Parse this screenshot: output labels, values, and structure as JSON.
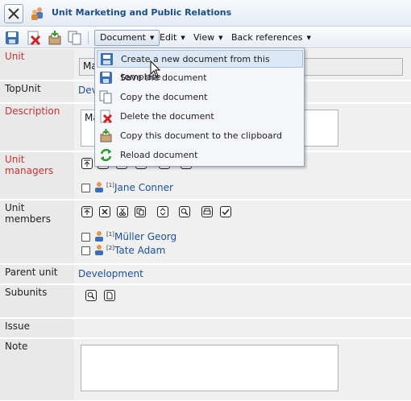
{
  "window": {
    "title": "Unit Marketing and Public Relations"
  },
  "toolbar": {
    "menus": [
      {
        "label": "Document"
      },
      {
        "label": "Edit"
      },
      {
        "label": "View"
      },
      {
        "label": "Back references"
      }
    ]
  },
  "document_menu": {
    "items": [
      {
        "label": "Create a new document from this template",
        "icon": "template-icon"
      },
      {
        "label": "Save the document",
        "icon": "save-icon"
      },
      {
        "label": "Copy the document",
        "icon": "copy-icon"
      },
      {
        "label": "Delete the document",
        "icon": "delete-icon"
      },
      {
        "label": "Copy this document to the clipboard",
        "icon": "clipboard-icon"
      },
      {
        "label": "Reload document",
        "icon": "reload-icon"
      }
    ]
  },
  "form": {
    "unit": {
      "label": "Unit",
      "value": "Ma"
    },
    "topunit": {
      "label": "TopUnit",
      "value": "Dev"
    },
    "description": {
      "label": "Description",
      "value": "Ma"
    },
    "unit_managers": {
      "label": "Unit managers",
      "people": [
        {
          "index": "[1]",
          "name": "Jane Conner"
        }
      ]
    },
    "unit_members": {
      "label": "Unit members",
      "people": [
        {
          "index": "[1]",
          "name": "Müller Georg"
        },
        {
          "index": "[2]",
          "name": "Tate Adam"
        }
      ]
    },
    "parent_unit": {
      "label": "Parent unit",
      "value": "Development"
    },
    "subunits": {
      "label": "Subunits"
    },
    "issue": {
      "label": "Issue"
    },
    "note": {
      "label": "Note",
      "value": ""
    }
  },
  "colors": {
    "required_label": "#c83232",
    "link": "#1b4f9a",
    "label_bg": "#e9e9e9",
    "value_bg": "#f0f0f0"
  }
}
